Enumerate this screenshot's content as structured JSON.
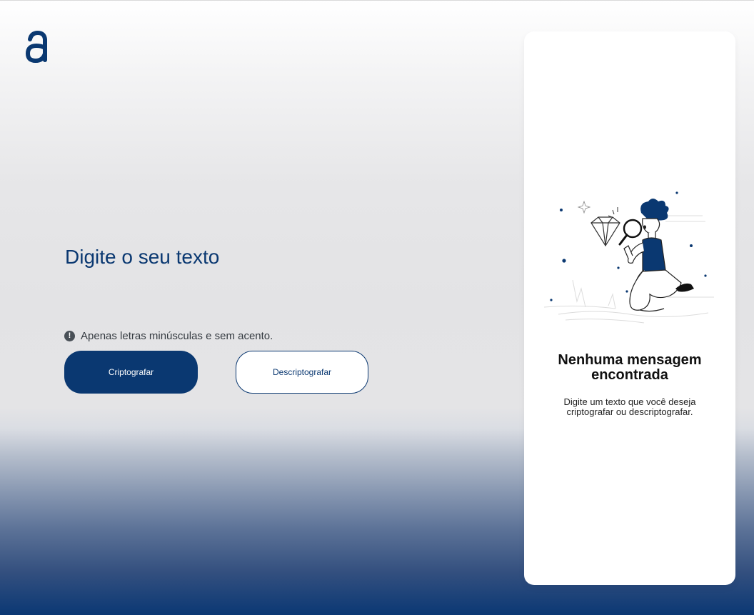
{
  "logo": {
    "icon": "alura-logo-icon",
    "color": "#0a3871"
  },
  "input": {
    "placeholder": "Digite o seu texto",
    "value": ""
  },
  "hint": {
    "icon": "exclamation-circle-icon",
    "text": "Apenas letras minúsculas e sem acento."
  },
  "buttons": {
    "encrypt": "Criptografar",
    "decrypt": "Descriptografar"
  },
  "output_panel": {
    "illustration": "person-with-magnifying-glass-illustration",
    "title": "Nenhuma mensagem encontrada",
    "text": "Digite um texto que você deseja criptografar ou descriptografar."
  },
  "colors": {
    "primary": "#0a3871",
    "text_dark": "#343a40"
  }
}
